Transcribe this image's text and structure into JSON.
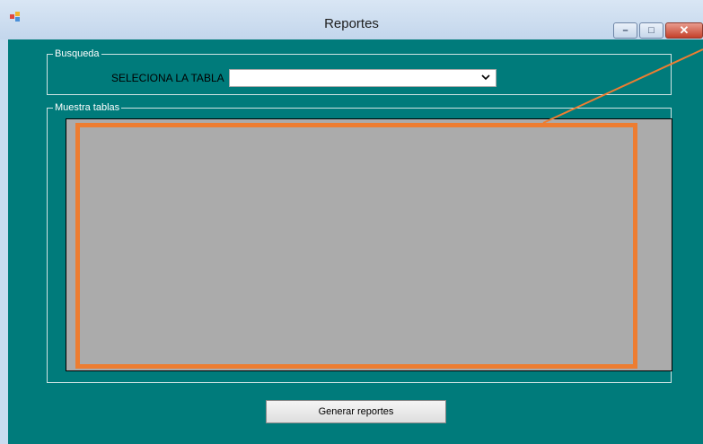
{
  "window": {
    "title": "Reportes",
    "app_icon": "app-icon",
    "controls": {
      "minimize": "–",
      "maximize": "□",
      "close": "✕"
    }
  },
  "busqueda": {
    "legend": "Busqueda",
    "label": "SELECIONA LA TABLA",
    "combo_value": "",
    "combo_icon": "chevron-down-icon"
  },
  "muestra": {
    "legend": "Muestra tablas"
  },
  "actions": {
    "generate_label": "Generar reportes"
  },
  "colors": {
    "client_bg": "#007b7b",
    "grid_bg": "#ababab",
    "highlight": "#ed7d31"
  }
}
